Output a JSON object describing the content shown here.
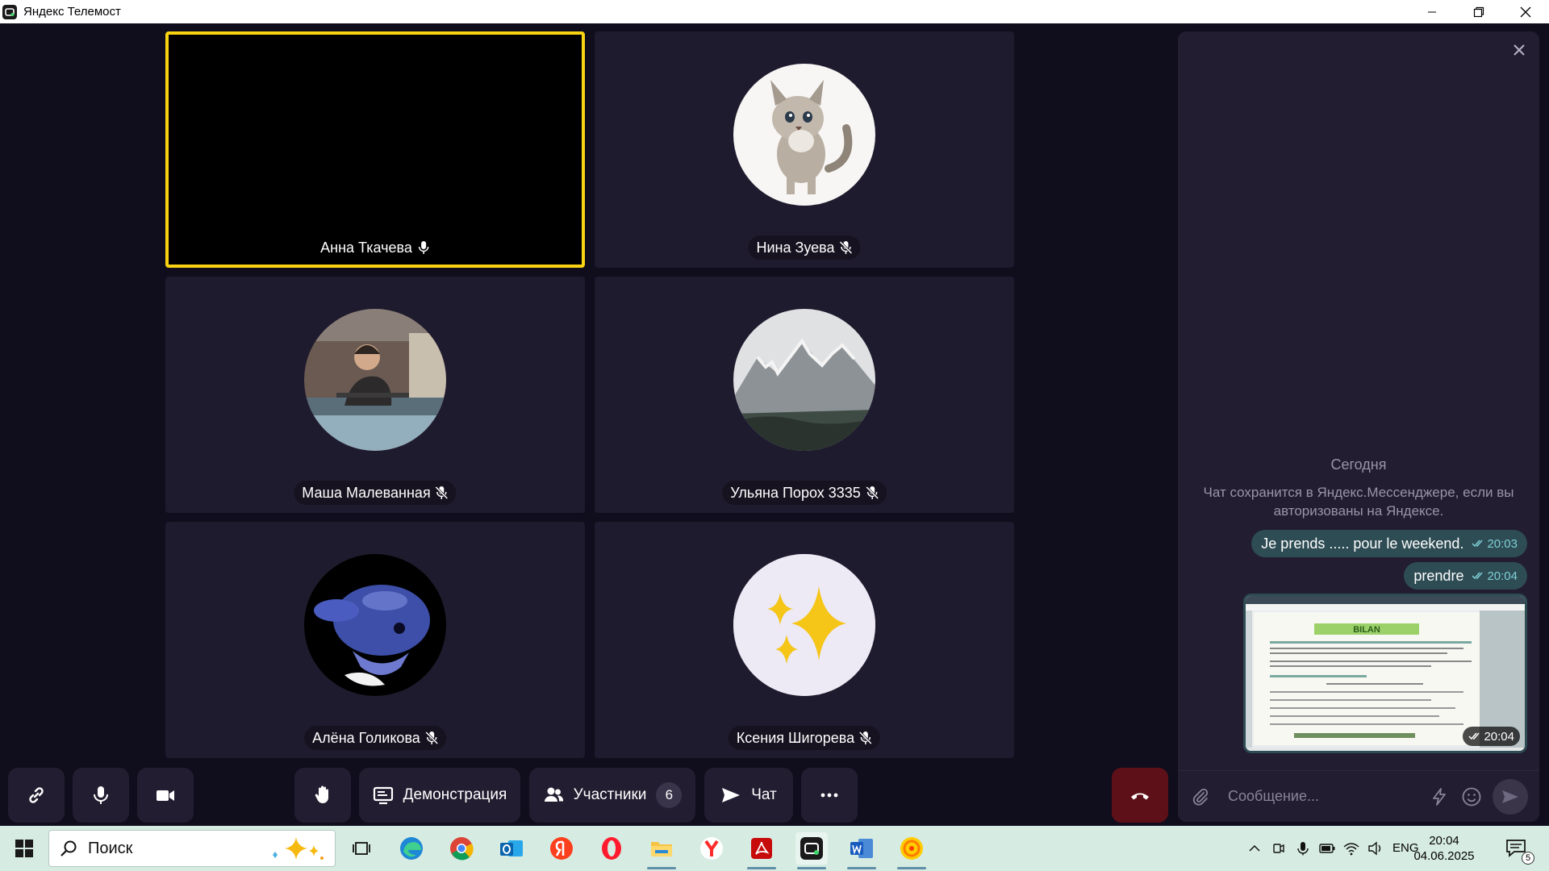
{
  "window": {
    "title": "Яндекс Телемост"
  },
  "participants": [
    {
      "name": "Анна Ткачева",
      "mic": "on",
      "active": true
    },
    {
      "name": "Нина Зуева",
      "mic": "muted"
    },
    {
      "name": "Маша Малеванная",
      "mic": "muted"
    },
    {
      "name": "Ульяна Порох 3335",
      "mic": "muted"
    },
    {
      "name": "Алёна Голикова",
      "mic": "muted"
    },
    {
      "name": "Ксения Шигорева",
      "mic": "muted"
    }
  ],
  "toolbar": {
    "screen_share_label": "Демонстрация",
    "participants_label": "Участники",
    "participants_count": "6",
    "chat_label": "Чат"
  },
  "chat": {
    "day_label": "Сегодня",
    "notice": "Чат сохранится в Яндекс.Мессенджере, если вы авторизованы на Яндексе.",
    "messages": [
      {
        "text": "Je prends ..... pour le weekend.",
        "time": "20:03"
      },
      {
        "text": "prendre",
        "time": "20:04"
      }
    ],
    "image_message": {
      "time": "20:04",
      "image_heading": "BILAN"
    },
    "input_placeholder": "Сообщение..."
  },
  "taskbar": {
    "search_label": "Поиск",
    "language": "ENG",
    "time": "20:04",
    "date": "04.06.2025",
    "notification_count": "5"
  }
}
